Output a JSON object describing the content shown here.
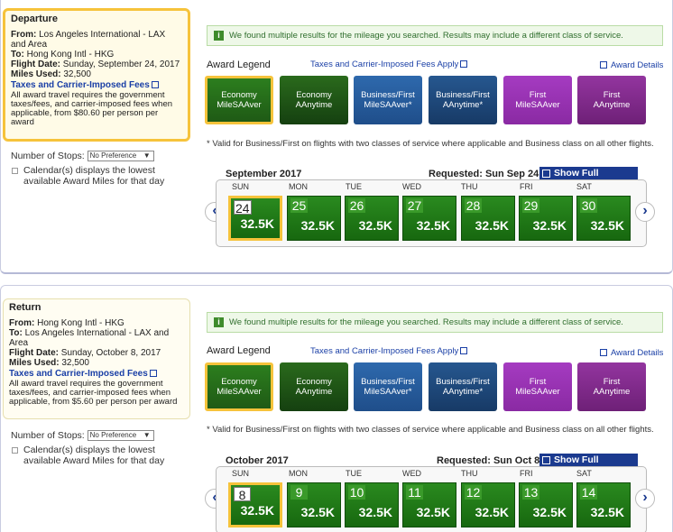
{
  "legend_title": "Award Legend",
  "taxes_link": "Taxes and Carrier-Imposed Fees Apply",
  "award_details": "Award Details",
  "info_message": "We found multiple results for the mileage you searched. Results may include a different class of service.",
  "footnote": "* Valid for Business/First on flights with two classes of service where applicable and Business class on all other flights.",
  "show_calendar": "Show Full Calendar",
  "legend": [
    {
      "line1": "Economy",
      "line2": "MileSAAver"
    },
    {
      "line1": "Economy",
      "line2": "AAnytime"
    },
    {
      "line1": "Business/First",
      "line2": "MileSAAver*"
    },
    {
      "line1": "Business/First",
      "line2": "AAnytime*"
    },
    {
      "line1": "First",
      "line2": "MileSAAver"
    },
    {
      "line1": "First",
      "line2": "AAnytime"
    }
  ],
  "stops_label": "Number of Stops:",
  "stops_value": "No Preference",
  "cal_note_1": "Calendar(s) displays the lowest",
  "cal_note_2": "available Award Miles for that day",
  "days_of_week": [
    "SUN",
    "MON",
    "TUE",
    "WED",
    "THU",
    "FRI",
    "SAT"
  ],
  "departure": {
    "title": "Departure",
    "from_label": "From:",
    "from": "Los Angeles International - LAX and Area",
    "to_label": "To:",
    "to": "Hong Kong Intl - HKG",
    "date_label": "Flight Date:",
    "date": "Sunday, September 24, 2017",
    "miles_label": "Miles Used:",
    "miles": "32,500",
    "tax_link": "Taxes and Carrier-Imposed Fees",
    "tax_note": "All award travel requires the government taxes/fees, and carrier-imposed fees when applicable, from $80.60 per person per award",
    "month": "September 2017",
    "requested": "Requested:  Sun Sep 24",
    "days": [
      {
        "num": "24",
        "price": "32.5K"
      },
      {
        "num": "25",
        "price": "32.5K"
      },
      {
        "num": "26",
        "price": "32.5K"
      },
      {
        "num": "27",
        "price": "32.5K"
      },
      {
        "num": "28",
        "price": "32.5K"
      },
      {
        "num": "29",
        "price": "32.5K"
      },
      {
        "num": "30",
        "price": "32.5K"
      }
    ]
  },
  "return": {
    "title": "Return",
    "from_label": "From:",
    "from": "Hong Kong Intl - HKG",
    "to_label": "To:",
    "to": "Los Angeles International - LAX and Area",
    "date_label": "Flight Date:",
    "date": "Sunday, October 8, 2017",
    "miles_label": "Miles Used:",
    "miles": "32,500",
    "tax_link": "Taxes and Carrier-Imposed Fees",
    "tax_note": "All award travel requires the government taxes/fees, and carrier-imposed fees when applicable, from $5.60 per person per award",
    "month": "October 2017",
    "requested": "Requested:  Sun Oct 8",
    "days": [
      {
        "num": "8",
        "price": "32.5K"
      },
      {
        "num": "9",
        "price": "32.5K"
      },
      {
        "num": "10",
        "price": "32.5K"
      },
      {
        "num": "11",
        "price": "32.5K"
      },
      {
        "num": "12",
        "price": "32.5K"
      },
      {
        "num": "13",
        "price": "32.5K"
      },
      {
        "num": "14",
        "price": "32.5K"
      }
    ]
  }
}
